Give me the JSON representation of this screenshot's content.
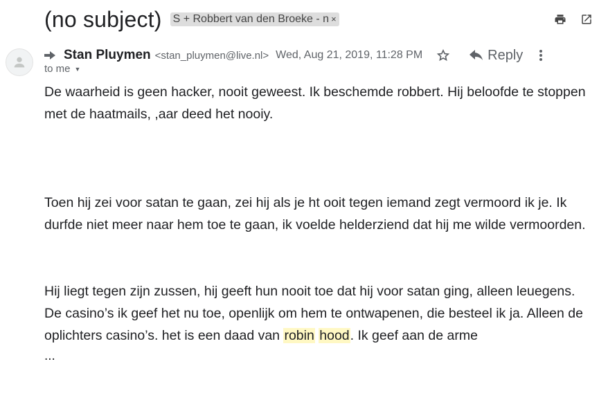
{
  "email": {
    "subject": "(no subject)",
    "label": "S + Robbert van den Broeke - n",
    "label_close": "×",
    "sender_name": "Stan Pluymen",
    "sender_email": "<stan_pluymen@live.nl>",
    "date": "Wed, Aug 21, 2019, 11:28 PM",
    "reply_label": "Reply",
    "to": "to me",
    "body": {
      "p1": "De waarheid is geen hacker, nooit geweest. Ik beschemde robbert. Hij beloofde te stoppen met de haatmails, ,aar deed het nooiy.",
      "p2": "Toen hij zei voor satan te gaan, zei hij als je ht ooit tegen iemand zegt vermoord ik je. Ik durfde niet meer naar hem toe te gaan, ik voelde helderziend dat hij me wilde vermoorden.",
      "p3_a": "Hij liegt tegen zijn zussen, hij geeft hun nooit toe dat hij voor satan ging, alleen leuegens. De casino’s ik geef het nu toe, openlijk om hem te ontwapenen, die besteel ik ja. Alleen de oplichters casino’s. het is een daad van ",
      "p3_hl1": "robin",
      "p3_space": " ",
      "p3_hl2": "hood",
      "p3_b": ". Ik geef aan de arme",
      "ellipsis": "..."
    }
  },
  "icons": {
    "print": "print-icon",
    "popout": "open-in-new-window-icon",
    "forward": "forwarded-arrow-icon",
    "star": "star-icon",
    "reply": "reply-arrow-icon",
    "more": "more-vert-icon",
    "avatar": "default-avatar-icon"
  }
}
